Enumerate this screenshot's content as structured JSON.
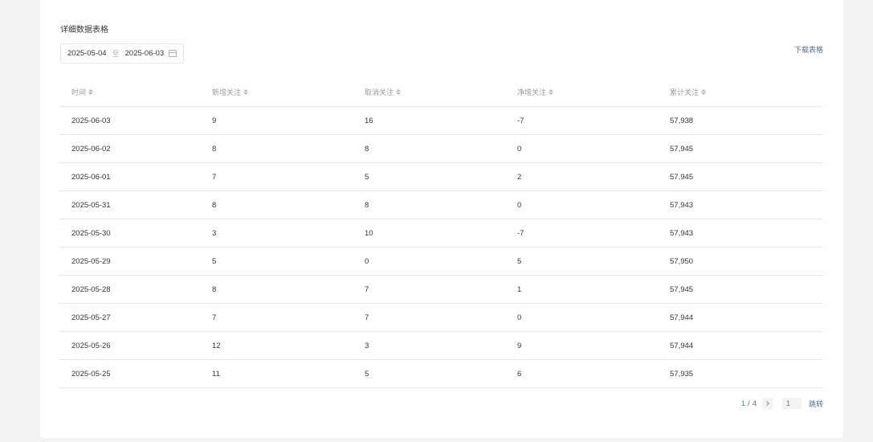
{
  "section_title": "详细数据表格",
  "date_range": {
    "start": "2025-05-04",
    "separator": "至",
    "end": "2025-06-03"
  },
  "download_label": "下载表格",
  "table": {
    "columns": [
      "时间",
      "新增关注",
      "取消关注",
      "净增关注",
      "累计关注"
    ],
    "rows": [
      [
        "2025-06-03",
        "9",
        "16",
        "-7",
        "57,938"
      ],
      [
        "2025-06-02",
        "8",
        "8",
        "0",
        "57,945"
      ],
      [
        "2025-06-01",
        "7",
        "5",
        "2",
        "57,945"
      ],
      [
        "2025-05-31",
        "8",
        "8",
        "0",
        "57,943"
      ],
      [
        "2025-05-30",
        "3",
        "10",
        "-7",
        "57,943"
      ],
      [
        "2025-05-29",
        "5",
        "0",
        "5",
        "57,950"
      ],
      [
        "2025-05-28",
        "8",
        "7",
        "1",
        "57,945"
      ],
      [
        "2025-05-27",
        "7",
        "7",
        "0",
        "57,944"
      ],
      [
        "2025-05-26",
        "12",
        "3",
        "9",
        "57,944"
      ],
      [
        "2025-05-25",
        "11",
        "5",
        "6",
        "57,935"
      ]
    ]
  },
  "pagination": {
    "current": "1",
    "separator": "/",
    "total": "4",
    "input_placeholder": "1",
    "jump_label": "跳转"
  },
  "colors": {
    "accent_green": "#07c160",
    "link_blue": "#576b95",
    "divider": "#e7e7eb"
  }
}
